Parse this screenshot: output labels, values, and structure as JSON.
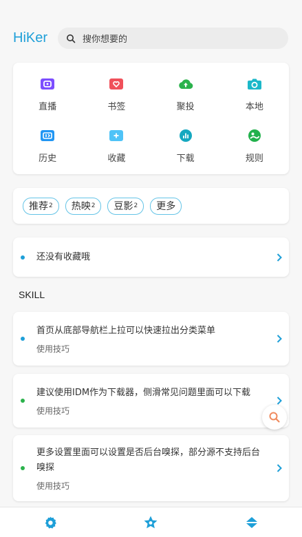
{
  "header": {
    "logo": "HiKer",
    "search_placeholder": "搜你想要的"
  },
  "grid": [
    {
      "label": "直播",
      "icon": "live-icon",
      "color": "#7c4dff"
    },
    {
      "label": "书签",
      "icon": "bookmark-icon",
      "color": "#f0505a"
    },
    {
      "label": "聚投",
      "icon": "cloud-upload-icon",
      "color": "#2bb24c"
    },
    {
      "label": "本地",
      "icon": "camera-icon",
      "color": "#1cb8c9"
    },
    {
      "label": "历史",
      "icon": "history-icon",
      "color": "#2196f3"
    },
    {
      "label": "收藏",
      "icon": "favorites-icon",
      "color": "#4fc3f7"
    },
    {
      "label": "下载",
      "icon": "download-icon",
      "color": "#15a8c0"
    },
    {
      "label": "规则",
      "icon": "rules-icon",
      "color": "#22b14c"
    }
  ],
  "chips": [
    {
      "label": "推荐",
      "sub": "2"
    },
    {
      "label": "热映",
      "sub": "2"
    },
    {
      "label": "豆影",
      "sub": "2"
    },
    {
      "label": "更多",
      "sub": ""
    }
  ],
  "favorites": {
    "empty_text": "还没有收藏哦",
    "dot_color": "#1e9fd8"
  },
  "skill": {
    "title": "SKILL",
    "tips": [
      {
        "text": "首页从底部导航栏上拉可以快速拉出分类菜单",
        "sub": "使用技巧",
        "dot_color": "#1e9fd8"
      },
      {
        "text": "建议使用IDM作为下载器，侧滑常见问题里面可以下载",
        "sub": "使用技巧",
        "dot_color": "#2bb24c"
      },
      {
        "text": "更多设置里面可以设置是否后台嗅探，部分源不支持后台嗅探",
        "sub": "使用技巧",
        "dot_color": "#2bb24c"
      }
    ]
  },
  "colors": {
    "accent": "#1e9fd8",
    "fab_icon": "#f08a5d"
  },
  "bottom_nav": [
    {
      "icon": "settings-gear-icon"
    },
    {
      "icon": "star-icon"
    },
    {
      "icon": "sort-arrows-icon"
    }
  ]
}
